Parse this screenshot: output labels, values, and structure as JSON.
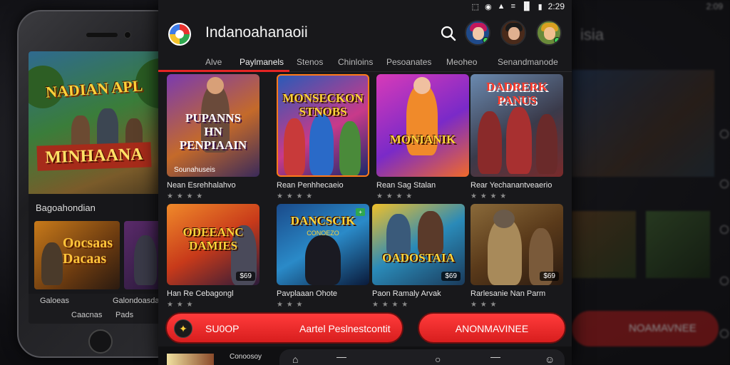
{
  "left_phone": {
    "hero_title_top": "NADIAN APL",
    "hero_title_bottom": "MINHAANA",
    "section_label": "Bagoahondian",
    "thumb1_title": "Oocsaas\nDacaas",
    "tabbar": [
      "Galoeas",
      "Caacnas",
      "Pads",
      "Galondoasda"
    ]
  },
  "status_bar": {
    "time": "2:29"
  },
  "app": {
    "title": "Indanoahanaoii",
    "search_icon": "search-icon",
    "tabs": [
      {
        "label": "Alve",
        "active": false
      },
      {
        "label": "Paylmanels",
        "active": true
      },
      {
        "label": "Stenos",
        "active": false
      },
      {
        "label": "Chinloins",
        "active": false
      },
      {
        "label": "Pesoanates",
        "active": false
      },
      {
        "label": "Meoheo",
        "active": false
      },
      {
        "label": "Senandmanode",
        "active": false
      }
    ],
    "accent_color": "#e52424"
  },
  "games_row1": [
    {
      "art_title": "PUPANNS\nHN\nPENPIAAIN",
      "art_sub": "Sounahuseis",
      "name": "Nean Esrehhalahvo",
      "stars": "★ ★ ★ ★"
    },
    {
      "art_title": "MONSECKON\nSTNOBS",
      "name": "Rean Penhhecaeio",
      "stars": "★ ★ ★ ★"
    },
    {
      "art_title": "MONIANIK",
      "name": "Rean Sag Stalan",
      "stars": "★ ★ ★ ★"
    },
    {
      "art_title": "DADRERK\nPANUS",
      "name": "Rear Yechanantveaerio",
      "stars": "★ ★ ★ ★"
    }
  ],
  "games_row2": [
    {
      "art_title": "ODEEANC\nDAMIES",
      "badge": "$69",
      "name": "Han Re Cebagongl",
      "stars": "★ ★ ★"
    },
    {
      "art_title": "DANCSCIK",
      "art_sub": "CONOEZO",
      "name": "Pavplaaan Ohote",
      "stars": "★ ★ ★"
    },
    {
      "art_title": "OADOSTAIA",
      "badge": "$69",
      "name": "Paon Ramaly Arvak",
      "stars": "★ ★ ★ ★"
    },
    {
      "art_title": "",
      "badge": "$69",
      "name": "Rarlesanie Nan Parm",
      "stars": "★ ★ ★"
    }
  ],
  "buttons": {
    "shop_label": "SU0OP",
    "shop_sub": "Aartel Peslnestcontit",
    "install_label": "ANONMAVINEE"
  },
  "bottom": {
    "mini_label": "Conoosoy"
  },
  "right_phone": {
    "time": "2:09",
    "title": "isia",
    "button_label": "NOAMAVNEE"
  }
}
